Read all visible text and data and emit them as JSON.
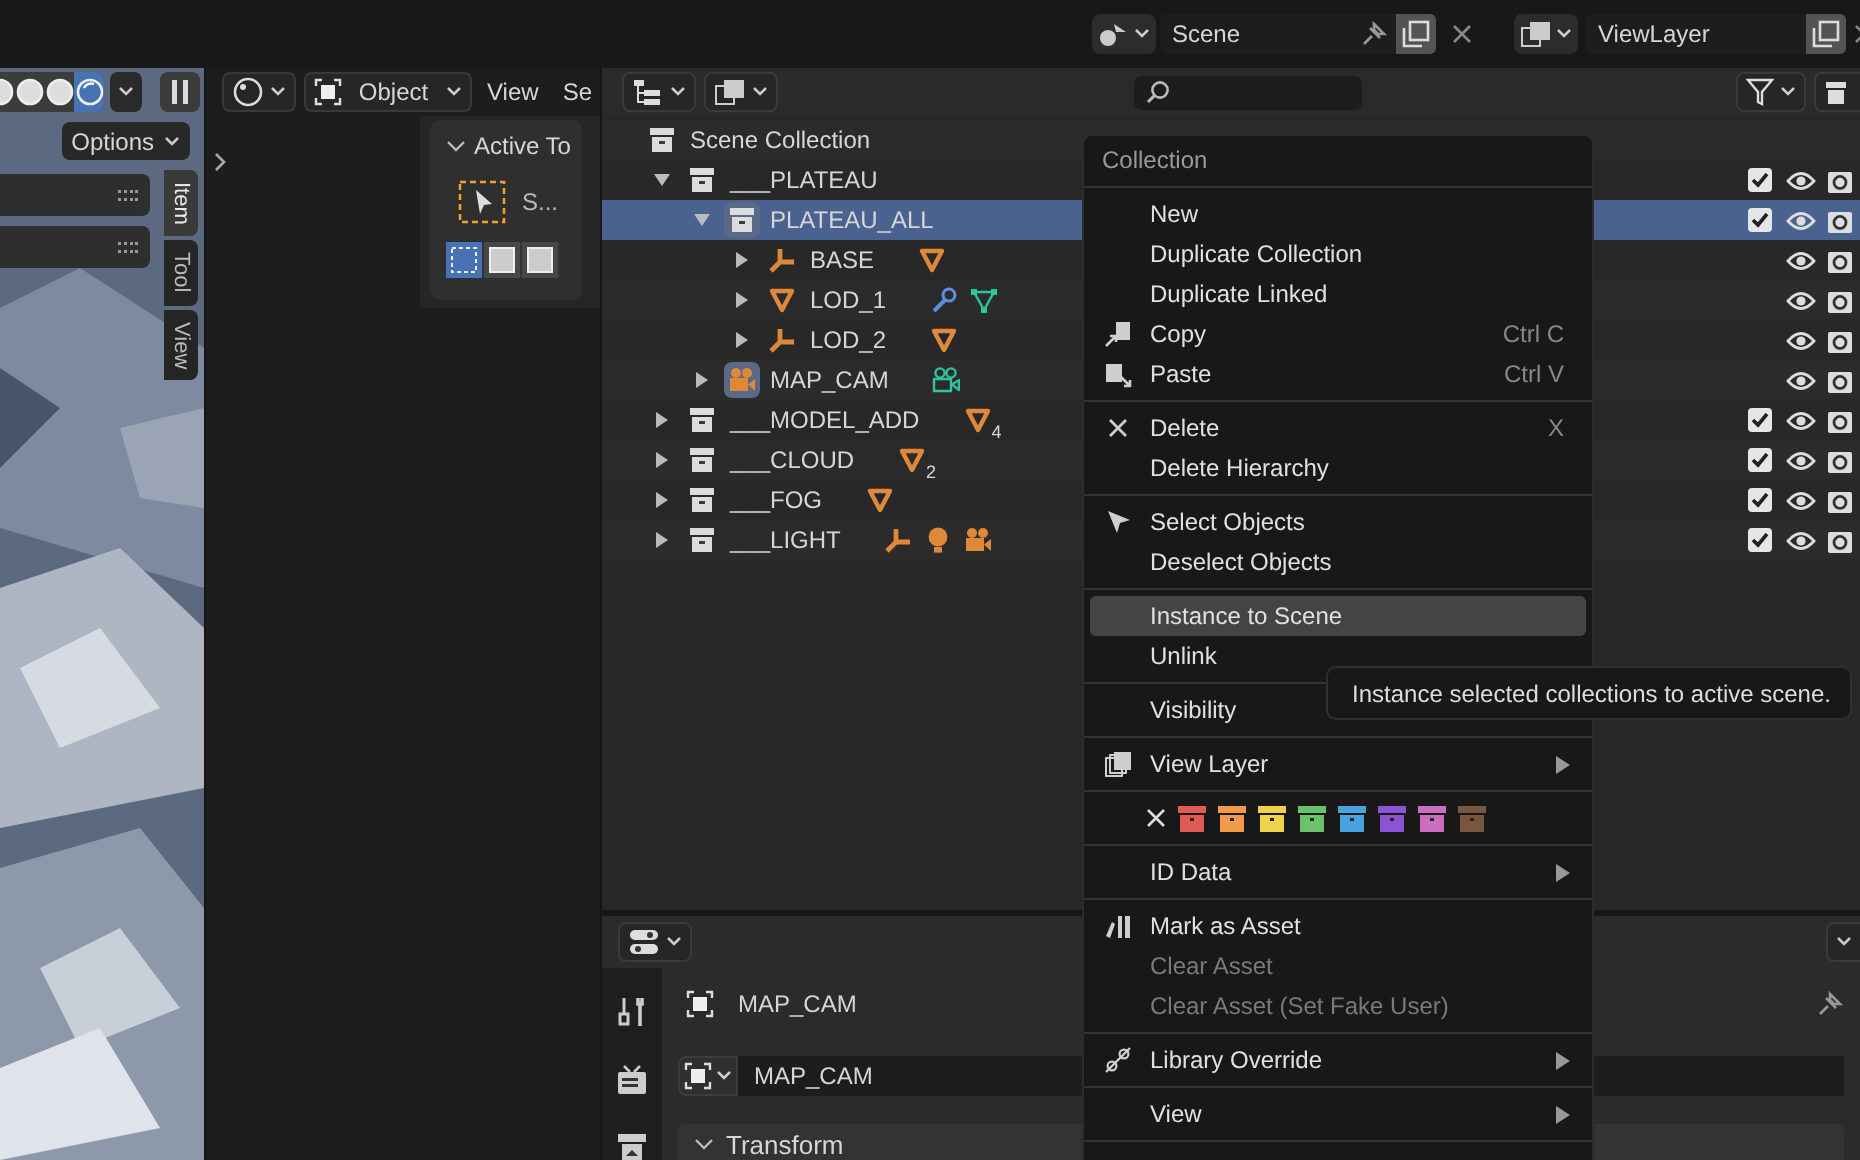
{
  "top_bar": {
    "scene_name": "Scene",
    "view_layer_name": "ViewLayer"
  },
  "viewport": {
    "shading_modes": [
      {
        "selected": false
      },
      {
        "selected": false
      },
      {
        "selected": false
      },
      {
        "selected": true
      }
    ],
    "options_label": "Options",
    "side_tabs": [
      {
        "label": "Item",
        "selected": true
      },
      {
        "label": "Tool",
        "selected": false
      },
      {
        "label": "View",
        "selected": false
      }
    ]
  },
  "editor_header": {
    "mode": "Object",
    "menus": [
      "View",
      "Se"
    ]
  },
  "tool_panel": {
    "title": "Active To",
    "tool_label": "S...",
    "select_modes": [
      {
        "selected": true
      },
      {
        "selected": false
      },
      {
        "selected": false
      }
    ]
  },
  "outliner": {
    "rows": [
      {
        "name": "Scene Collection",
        "kind": "collection",
        "children": [
          {
            "name": "___PLATEAU",
            "kind": "collection",
            "expanded": true,
            "selected": false,
            "exclude_checked": true,
            "children": [
              {
                "name": "PLATEAU_ALL",
                "kind": "collection",
                "active": true,
                "expanded": true,
                "selected": true,
                "exclude_checked": true,
                "children": [
                  {
                    "name": "BASE",
                    "kind": "empty",
                    "expanded": false,
                    "selected": false,
                    "extras": [
                      {
                        "kind": "mesh"
                      }
                    ]
                  },
                  {
                    "name": "LOD_1",
                    "kind": "mesh",
                    "expanded": false,
                    "selected": false,
                    "extras": [
                      {
                        "kind": "modifier"
                      },
                      {
                        "kind": "mesh_data"
                      }
                    ]
                  },
                  {
                    "name": "LOD_2",
                    "kind": "empty",
                    "expanded": false,
                    "selected": false,
                    "extras": [
                      {
                        "kind": "mesh"
                      }
                    ]
                  }
                ]
              },
              {
                "name": "MAP_CAM",
                "kind": "camera",
                "active": true,
                "expanded": false,
                "selected": false,
                "extras": [
                  {
                    "kind": "camera_data"
                  }
                ]
              }
            ]
          },
          {
            "name": "___MODEL_ADD",
            "kind": "collection",
            "expanded": false,
            "selected": false,
            "exclude_checked": true,
            "extras": [
              {
                "kind": "mesh",
                "count": "4"
              }
            ]
          },
          {
            "name": "___CLOUD",
            "kind": "collection",
            "expanded": false,
            "selected": false,
            "exclude_checked": true,
            "extras": [
              {
                "kind": "mesh",
                "count": "2"
              }
            ]
          },
          {
            "name": "___FOG",
            "kind": "collection",
            "expanded": false,
            "selected": false,
            "exclude_checked": true,
            "extras": [
              {
                "kind": "mesh"
              }
            ]
          },
          {
            "name": "___LIGHT",
            "kind": "collection",
            "expanded": false,
            "selected": false,
            "exclude_checked": true,
            "extras": [
              {
                "kind": "empty"
              },
              {
                "kind": "light"
              },
              {
                "kind": "camera"
              }
            ]
          }
        ]
      }
    ]
  },
  "properties": {
    "tabs": [
      {
        "kind": "tool"
      },
      {
        "kind": "render"
      },
      {
        "kind": "output"
      }
    ],
    "object_name": "MAP_CAM",
    "data_name": "MAP_CAM",
    "panel_title": "Transform"
  },
  "context_menu": {
    "title": "Collection",
    "items": [
      {
        "kind": "plain",
        "label": "New",
        "selected": false,
        "disabled": false
      },
      {
        "kind": "plain",
        "label": "Duplicate Collection",
        "selected": false,
        "disabled": false
      },
      {
        "kind": "plain",
        "label": "Duplicate Linked",
        "selected": false,
        "disabled": false
      },
      {
        "kind": "copy",
        "label": "Copy",
        "shortcut": "Ctrl C",
        "selected": false,
        "disabled": false
      },
      {
        "kind": "paste",
        "label": "Paste",
        "shortcut": "Ctrl V",
        "selected": false,
        "disabled": false
      },
      {
        "kind": "separator"
      },
      {
        "kind": "delete",
        "label": "Delete",
        "shortcut": "X",
        "selected": false,
        "disabled": false
      },
      {
        "kind": "plain",
        "label": "Delete Hierarchy",
        "selected": false,
        "disabled": false
      },
      {
        "kind": "separator"
      },
      {
        "kind": "cursor",
        "label": "Select Objects",
        "selected": false,
        "disabled": false
      },
      {
        "kind": "plain",
        "label": "Deselect Objects",
        "selected": false,
        "disabled": false
      },
      {
        "kind": "separator"
      },
      {
        "kind": "plain",
        "label": "Instance to Scene",
        "selected": true,
        "disabled": false
      },
      {
        "kind": "plain",
        "label": "Unlink",
        "selected": false,
        "disabled": false
      },
      {
        "kind": "separator"
      },
      {
        "kind": "plain",
        "label": "Visibility",
        "selected": false,
        "disabled": false
      },
      {
        "kind": "separator"
      },
      {
        "kind": "view_layer",
        "label": "View Layer",
        "submenu": true,
        "selected": false,
        "disabled": false
      },
      {
        "kind": "separator"
      },
      {
        "kind": "color_tags",
        "tags": [
          {
            "color": "#e05b56"
          },
          {
            "color": "#f09a4b"
          },
          {
            "color": "#ecd34a"
          },
          {
            "color": "#6ac36a"
          },
          {
            "color": "#4aa3e0"
          },
          {
            "color": "#8d52d6"
          },
          {
            "color": "#c96ec0"
          },
          {
            "color": "#7a5640"
          }
        ]
      },
      {
        "kind": "separator"
      },
      {
        "kind": "plain",
        "label": "ID Data",
        "submenu": true,
        "selected": false,
        "disabled": false
      },
      {
        "kind": "separator"
      },
      {
        "kind": "asset",
        "label": "Mark as Asset",
        "selected": false,
        "disabled": false
      },
      {
        "kind": "plain",
        "label": "Clear Asset",
        "selected": false,
        "disabled": true
      },
      {
        "kind": "plain",
        "label": "Clear Asset (Set Fake User)",
        "selected": false,
        "disabled": true
      },
      {
        "kind": "separator"
      },
      {
        "kind": "override",
        "label": "Library Override",
        "submenu": true,
        "selected": false,
        "disabled": false
      },
      {
        "kind": "separator"
      },
      {
        "kind": "plain",
        "label": "View",
        "submenu": true,
        "selected": false,
        "disabled": false
      },
      {
        "kind": "separator"
      }
    ]
  },
  "tooltip": {
    "text": "Instance selected collections to active scene."
  }
}
